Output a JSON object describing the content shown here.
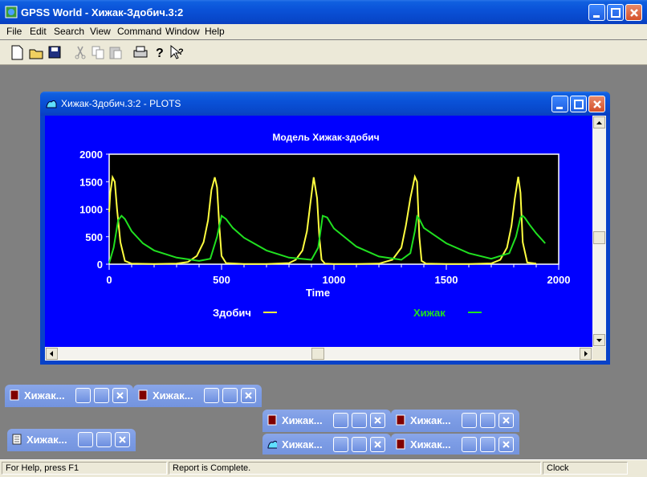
{
  "app": {
    "title": "GPSS World - Хижак-Здобич.3:2"
  },
  "menu": [
    "File",
    "Edit",
    "Search",
    "View",
    "Command",
    "Window",
    "Help"
  ],
  "toolbar": {
    "icons": [
      "new-icon",
      "open-icon",
      "save-icon",
      "cut-icon",
      "copy-icon",
      "paste-icon",
      "print-icon",
      "help-icon",
      "context-help-icon"
    ]
  },
  "plots_window": {
    "title": "Хижак-Здобич.3:2  -  PLOTS"
  },
  "chart_data": {
    "type": "line",
    "title": "Модель Хижак-здобич",
    "xlabel": "Time",
    "ylabel": "",
    "xlim": [
      0,
      2000
    ],
    "ylim": [
      0,
      2000
    ],
    "x_ticks": [
      "0",
      "500",
      "1000",
      "1500",
      "2000"
    ],
    "y_ticks": [
      "2000",
      "1500",
      "1000",
      "500",
      "0"
    ],
    "grid": false,
    "legend": "bottom",
    "series": [
      {
        "name": "Здобич",
        "color": "#ffff40",
        "x": [
          0,
          5,
          15,
          25,
          35,
          50,
          70,
          100,
          200,
          300,
          350,
          390,
          420,
          440,
          455,
          470,
          480,
          490,
          500,
          520,
          600,
          700,
          800,
          830,
          860,
          880,
          895,
          910,
          925,
          935,
          945,
          960,
          1000,
          1100,
          1200,
          1260,
          1300,
          1320,
          1340,
          1360,
          1370,
          1380,
          1390,
          1410,
          1500,
          1600,
          1700,
          1740,
          1770,
          1790,
          1805,
          1820,
          1830,
          1840,
          1860,
          1900
        ],
        "values": [
          950,
          1300,
          1580,
          1500,
          1000,
          400,
          60,
          10,
          5,
          10,
          40,
          150,
          400,
          800,
          1350,
          1580,
          1400,
          700,
          150,
          20,
          5,
          5,
          20,
          80,
          250,
          600,
          1100,
          1580,
          1200,
          500,
          80,
          10,
          5,
          5,
          10,
          80,
          300,
          700,
          1200,
          1590,
          1500,
          500,
          60,
          10,
          5,
          5,
          15,
          80,
          300,
          700,
          1200,
          1590,
          1300,
          400,
          30,
          10
        ]
      },
      {
        "name": "Хижак",
        "color": "#20e020",
        "x": [
          0,
          20,
          40,
          55,
          70,
          100,
          150,
          200,
          300,
          400,
          450,
          480,
          500,
          520,
          550,
          600,
          700,
          800,
          900,
          930,
          950,
          970,
          1000,
          1100,
          1200,
          1300,
          1340,
          1360,
          1370,
          1380,
          1400,
          1450,
          1500,
          1600,
          1700,
          1780,
          1810,
          1830,
          1840,
          1850,
          1870,
          1900,
          1940
        ],
        "values": [
          20,
          300,
          800,
          880,
          820,
          600,
          380,
          250,
          120,
          60,
          100,
          500,
          880,
          820,
          660,
          480,
          250,
          120,
          80,
          300,
          880,
          850,
          650,
          320,
          140,
          80,
          200,
          600,
          870,
          820,
          660,
          520,
          380,
          200,
          100,
          200,
          500,
          850,
          880,
          840,
          720,
          560,
          380
        ]
      }
    ]
  },
  "minimized_windows": [
    {
      "label": "Хижак...",
      "icon": "report-icon"
    },
    {
      "label": "Хижак...",
      "icon": "report-icon"
    },
    {
      "label": "Хижак...",
      "icon": "report-icon"
    },
    {
      "label": "Хижак...",
      "icon": "report-icon"
    },
    {
      "label": "Хижак...",
      "icon": "model-text-icon"
    },
    {
      "label": "Хижак...",
      "icon": "plot-icon"
    },
    {
      "label": "Хижак...",
      "icon": "report-icon"
    }
  ],
  "status": {
    "help": "For Help, press F1",
    "message": "Report is Complete.",
    "clock": "Clock"
  },
  "colors": {
    "plot_bg": "#0000ff",
    "chart_bg": "#000000",
    "titlebar": "#0a52d8"
  }
}
